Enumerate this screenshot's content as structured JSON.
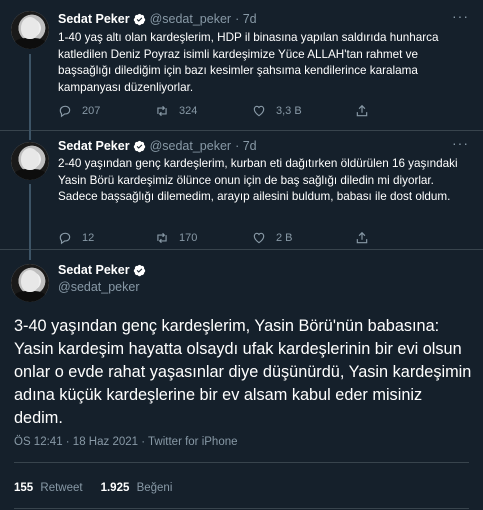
{
  "tweets": [
    {
      "name": "Sedat Peker",
      "handle": "@sedat_peker",
      "time": "· 7d",
      "text": "1-40 yaş altı olan kardeşlerim, HDP il binasına yapılan saldırıda hunharca katledilen Deniz Poyraz isimli kardeşimize Yüce ALLAH'tan rahmet ve başsağlığı dilediğim için bazı kesimler şahsıma kendilerince karalama kampanyası düzenliyorlar.",
      "replies": "207",
      "retweets": "324",
      "likes": "3,3 B",
      "icons": [
        "reply-icon",
        "retweet-icon",
        "like-icon",
        "share-icon"
      ]
    },
    {
      "name": "Sedat Peker",
      "handle": "@sedat_peker",
      "time": "· 7d",
      "text": "2-40 yaşından genç kardeşlerim, kurban eti dağıtırken öldürülen 16 yaşındaki Yasin Börü kardeşimiz ölünce onun için de baş sağlığı diledin mi diyorlar. Sadece başsağlığı dilemedim, arayıp ailesini buldum, babası ile dost oldum.",
      "replies": "12",
      "retweets": "170",
      "likes": "2 B",
      "icons": [
        "reply-icon",
        "retweet-icon",
        "like-icon",
        "share-icon"
      ]
    }
  ],
  "main": {
    "name": "Sedat Peker",
    "handle": "@sedat_peker",
    "text": "3-40 yaşından genç kardeşlerim, Yasin Börü'nün babasına: Yasin kardeşim hayatta olsaydı ufak kardeşlerinin bir evi olsun onlar o evde rahat yaşasınlar diye düşünürdü, Yasin kardeşimin adına küçük kardeşlerine bir ev alsam kabul eder misiniz dedim.",
    "timestamp": "ÖS 12:41 · 18 Haz 2021 · Twitter for iPhone",
    "retweet_count": "155",
    "retweet_label": "Retweet",
    "like_count": "1.925",
    "like_label": "Beğeni"
  },
  "colors": {
    "background": "#15202b",
    "secondary_text": "#8899a6",
    "verified": "#ffffff",
    "divider": "#38444d"
  }
}
